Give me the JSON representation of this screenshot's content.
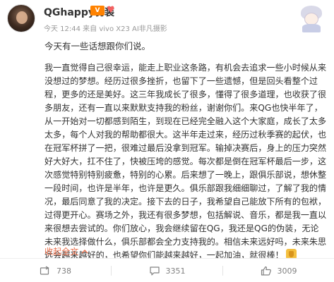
{
  "post": {
    "username": "QGhappy伪装",
    "vip_badge": "V",
    "meta": "今天 12:44 来自 vivo X23 AI非凡摄影",
    "headline": "今天有一些话想跟你们说。",
    "paragraphs": [
      "我一直觉得自己很幸运，能走上职业这条路，有机会去追求一些小时候从来没想过的梦想。经历过很多挫折，也留下了一些遗憾，但是回头看整个过程，更多的还是美好。这三年我成长了很多，懂得了很多道理，也收获了很多朋友，还有一直以来默默支持我的粉丝，谢谢你们。来QG也快半年了，从一开始对一切都感到陌生，到现在已经完全融入这个大家庭，成长了太多太多，每个人对我的帮助都很大。这半年走过来，经历过秋季赛的起伏，也在冠军杯拼了一把，很难过最后没拿到冠军。输掉决赛后，身上的压力突然好大好大，扛不住了，快被压垮的感觉。每次都是倒在冠军杯最后一步，这次感觉特别特别疲惫，特别的心累。后来想了一晚上，跟俱乐部说，想休整一段时间，也许是半年，也许是更久。俱乐部跟我细细聊过，了解了我的情况，最后同意了我的决定。接下去的日子，我希望自己能放下所有的包袱，过得更开心。赛场之外，我还有很多梦想，包括解说、音乐，都是我一直以来很想去尝试的。你们放心，我会继续留在QG，我还是QG的伪装，无论未来我选择做什么，俱乐部都会全力支持我的。相信未来远好吗，未来朱思远会越来越好的，也希望你们能越来越好，一起加油，就很棒！"
    ],
    "expand_label": "收起全文",
    "expand_icon": "chevron-up-icon"
  },
  "actions": {
    "repost": {
      "count": "738",
      "icon": "repost-icon"
    },
    "comment": {
      "count": "3351",
      "icon": "comment-icon"
    },
    "like": {
      "count": "3009",
      "icon": "like-icon"
    }
  },
  "colors": {
    "link": "#eb7350",
    "vip": "#ff8200",
    "muted": "#999999",
    "text": "#333333"
  }
}
